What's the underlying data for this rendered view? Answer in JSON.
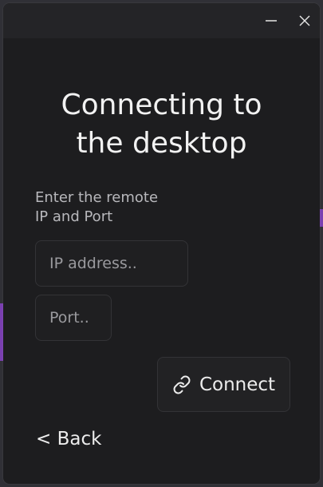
{
  "window": {
    "minimize_icon": "minimize-icon",
    "close_icon": "close-icon"
  },
  "heading": {
    "line1": "Connecting to",
    "line2": "the desktop"
  },
  "instruction": {
    "line1": "Enter the remote",
    "line2": "IP and Port"
  },
  "form": {
    "ip_placeholder": "IP address..",
    "ip_value": "",
    "port_placeholder": "Port..",
    "port_value": ""
  },
  "connect_button": {
    "label": "Connect",
    "icon": "link-icon"
  },
  "back_link": {
    "label": "< Back"
  },
  "colors": {
    "window_bg": "#1d1d1f",
    "titlebar_bg": "#242427",
    "accent_purple": "#7a3fb0"
  }
}
